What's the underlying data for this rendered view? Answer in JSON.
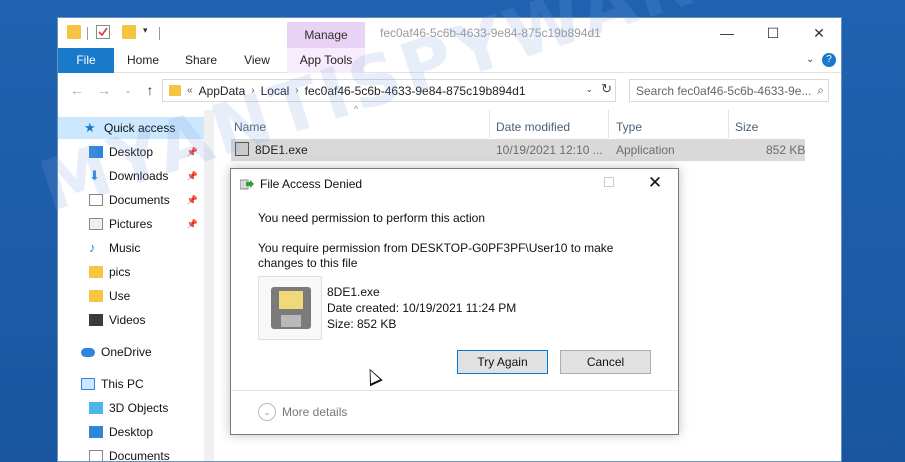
{
  "window": {
    "title": "fec0af46-5c6b-4633-9e84-875c19b894d1",
    "minimize_glyph": "—",
    "maximize_glyph": "☐",
    "close_glyph": "✕"
  },
  "ribbon": {
    "manage_label": "Manage",
    "tabs": [
      "File",
      "Home",
      "Share",
      "View",
      "App Tools"
    ],
    "help_glyph": "?"
  },
  "address": {
    "overflow": "«",
    "parts": [
      "AppData",
      "Local",
      "fec0af46-5c6b-4633-9e84-875c19b894d1"
    ],
    "search_placeholder": "Search fec0af46-5c6b-4633-9e..."
  },
  "nav": {
    "items": [
      {
        "label": "Quick access",
        "icon": "star-icon",
        "selected": true
      },
      {
        "label": "Desktop",
        "icon": "desktop-icon",
        "pinned": true
      },
      {
        "label": "Downloads",
        "icon": "download-icon",
        "pinned": true
      },
      {
        "label": "Documents",
        "icon": "documents-icon",
        "pinned": true
      },
      {
        "label": "Pictures",
        "icon": "pictures-icon",
        "pinned": true
      },
      {
        "label": "Music",
        "icon": "music-icon"
      },
      {
        "label": "pics",
        "icon": "folder-icon"
      },
      {
        "label": "Use",
        "icon": "folder-icon"
      },
      {
        "label": "Videos",
        "icon": "videos-icon"
      },
      {
        "label": "OneDrive",
        "icon": "cloud-icon"
      },
      {
        "label": "This PC",
        "icon": "pc-icon"
      },
      {
        "label": "3D Objects",
        "icon": "cube-icon"
      },
      {
        "label": "Desktop",
        "icon": "desktop-icon"
      },
      {
        "label": "Documents",
        "icon": "documents-icon"
      }
    ]
  },
  "filelist": {
    "columns": [
      "Name",
      "Date modified",
      "Type",
      "Size"
    ],
    "rows": [
      {
        "name": "8DE1.exe",
        "date": "10/19/2021 12:10 ...",
        "type": "Application",
        "size": "852 KB"
      }
    ]
  },
  "watermark": "MYANTISPYWARE.COM",
  "dialog": {
    "title": "File Access Denied",
    "heading": "You need permission to perform this action",
    "message": "You require permission from DESKTOP-G0PF3PF\\User10 to make changes to this file",
    "file_name": "8DE1.exe",
    "date_created": "Date created: 10/19/2021 11:24 PM",
    "size": "Size: 852 KB",
    "try_again": "Try Again",
    "cancel": "Cancel",
    "more_details": "More details",
    "close_glyph": "✕"
  },
  "colors": {
    "accent": "#1979ca",
    "manage_tab": "#e8d2f5",
    "selection": "#cce8ff"
  }
}
